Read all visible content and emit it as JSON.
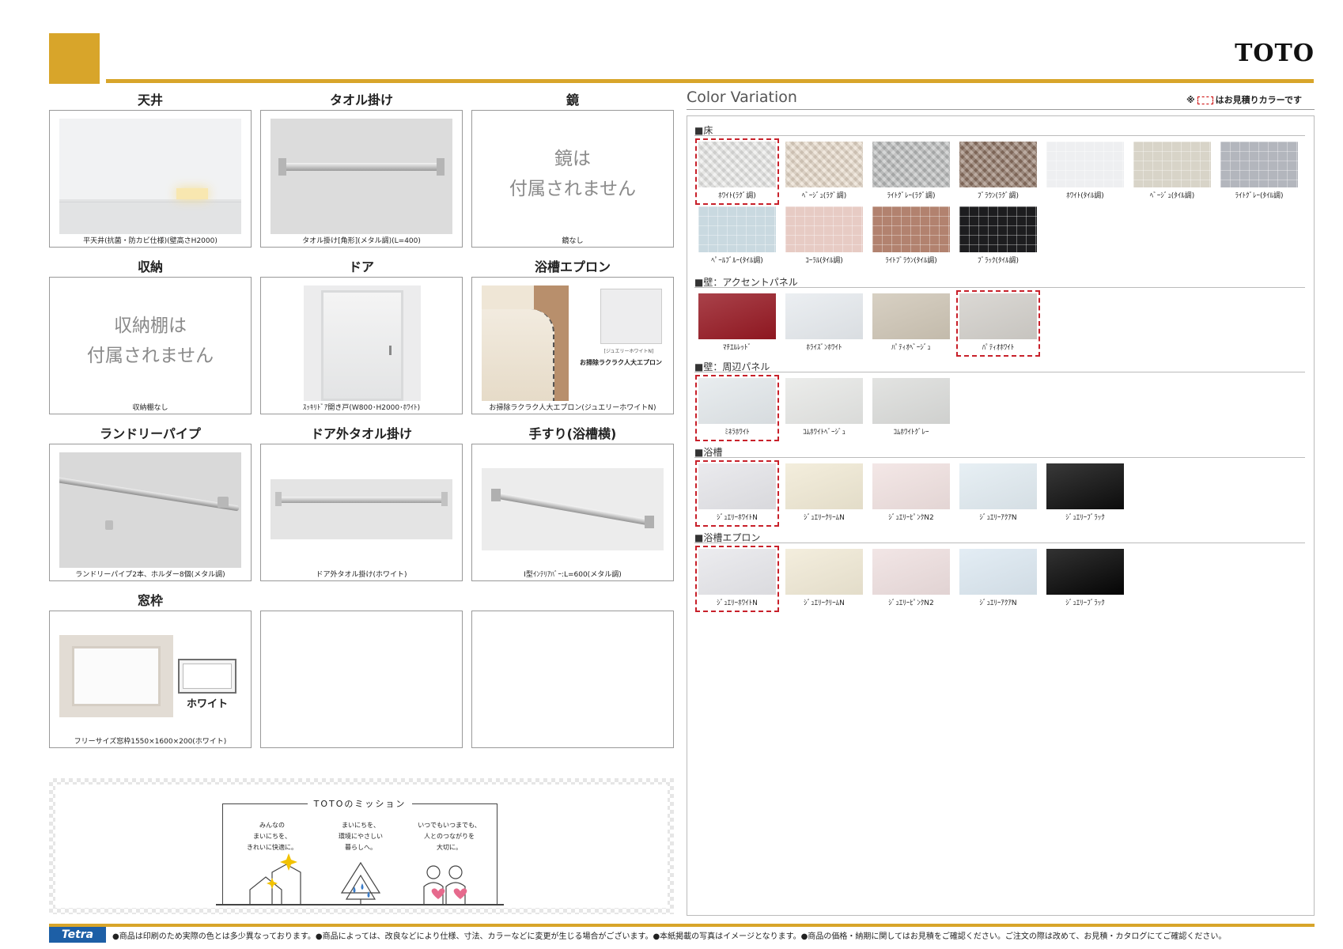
{
  "header": {
    "brand": "TOTO"
  },
  "options": [
    {
      "title": "天井",
      "caption": "平天井(抗菌・防カビ仕様)(壁高さH2000)"
    },
    {
      "title": "タオル掛け",
      "caption": "タオル掛け[角形](メタル調)(L=400)"
    },
    {
      "title": "鏡",
      "caption": "鏡なし",
      "notice": [
        "鏡は",
        "付属されません"
      ]
    },
    {
      "title": "収納",
      "caption": "収納棚なし",
      "notice": [
        "収納棚は",
        "付属されません"
      ]
    },
    {
      "title": "ドア",
      "caption": "ｽｯｷﾘﾄﾞｱ開き戸(W800･H2000･ﾎﾜｲﾄ)"
    },
    {
      "title": "浴槽エプロン",
      "caption": "お掃除ラクラク人大エプロン(ジュエリーホワイトN)",
      "inset_label": "[ジュエリーホワイトN]",
      "inset_note": "お掃除ラクラク人大エプロン"
    },
    {
      "title": "ランドリーパイプ",
      "caption": "ランドリーパイプ2本、ホルダー8個(メタル調)"
    },
    {
      "title": "ドア外タオル掛け",
      "caption": "ドア外タオル掛け(ホワイト)"
    },
    {
      "title": "手すり(浴槽横)",
      "caption": "I型ｲﾝﾃﾘｱﾊﾞｰ:L=600(メタル調)"
    },
    {
      "title": "窓枠",
      "caption": "フリーサイズ窓枠1550×1600×200(ホワイト)",
      "inset_label": "ホワイト"
    }
  ],
  "mission": {
    "title": "TOTOのミッション",
    "columns": [
      [
        "みんなの",
        "まいにちを、",
        "きれいに快適に。"
      ],
      [
        "まいにちを、",
        "環境にやさしい",
        "暮らしへ。"
      ],
      [
        "いつでもいつまでも、",
        "人とのつながりを",
        "大切に。"
      ]
    ]
  },
  "color_variation": {
    "title": "Color Variation",
    "note_prefix": "※",
    "note_suffix": "はお見積りカラーです",
    "selected_color": "#c8202a",
    "sections": [
      {
        "label": "■床",
        "swatches": [
          {
            "name": "ﾎﾜｲﾄ(ﾗｸﾞ調)",
            "color": "#e9e9e7",
            "pattern": "rag",
            "selected": true
          },
          {
            "name": "ﾍﾞｰｼﾞｭ(ﾗｸﾞ調)",
            "color": "#e6d8c8",
            "pattern": "rag"
          },
          {
            "name": "ﾗｲﾄｸﾞﾚｰ(ﾗｸﾞ調)",
            "color": "#b9bbbb",
            "pattern": "rag"
          },
          {
            "name": "ﾌﾞﾗｳﾝ(ﾗｸﾞ調)",
            "color": "#8d7363",
            "pattern": "rag"
          },
          {
            "name": "ﾎﾜｲﾄ(ﾀｲﾙ調)",
            "color": "#eeeff1",
            "pattern": "tile"
          },
          {
            "name": "ﾍﾞｰｼﾞｭ(ﾀｲﾙ調)",
            "color": "#d8d4c8",
            "pattern": "tile"
          },
          {
            "name": "ﾗｲﾄｸﾞﾚｰ(ﾀｲﾙ調)",
            "color": "#b3b6bd",
            "pattern": "tile"
          },
          {
            "name": "ﾍﾟｰﾙﾌﾞﾙｰ(ﾀｲﾙ調)",
            "color": "#c9d9e0",
            "pattern": "tile"
          },
          {
            "name": "ｺｰﾗﾙ(ﾀｲﾙ調)",
            "color": "#e7cbc4",
            "pattern": "tile"
          },
          {
            "name": "ﾗｲﾄﾌﾞﾗｳﾝ(ﾀｲﾙ調)",
            "color": "#b2826f",
            "pattern": "tile"
          },
          {
            "name": "ﾌﾞﾗｯｸ(ﾀｲﾙ調)",
            "color": "#1d1d1f",
            "pattern": "tile"
          }
        ]
      },
      {
        "label": "■壁：アクセントパネル",
        "swatches": [
          {
            "name": "ﾏﾁｴﾙﾚｯﾄﾞ",
            "color": "#961822",
            "pattern": "flat"
          },
          {
            "name": "ﾎﾗｲｽﾞﾝﾎﾜｲﾄ",
            "color": "#e7ebef",
            "pattern": "flat"
          },
          {
            "name": "ﾊﾟﾃｨｵﾍﾞｰｼﾞｭ",
            "color": "#cfc6b6",
            "pattern": "flat"
          },
          {
            "name": "ﾊﾟﾃｨｵﾎﾜｲﾄ",
            "color": "#d3d0cb",
            "pattern": "flat",
            "selected": true
          }
        ]
      },
      {
        "label": "■壁：周辺パネル",
        "swatches": [
          {
            "name": "ﾐﾈﾗﾎﾜｲﾄ",
            "color": "#e4e9ec",
            "pattern": "flat",
            "selected": true
          },
          {
            "name": "ｺﾑﾎﾜｲﾄﾍﾞｰｼﾞｭ",
            "color": "#e7e8e6",
            "pattern": "flat"
          },
          {
            "name": "ｺﾑﾎﾜｲﾄｸﾞﾚｰ",
            "color": "#dcdddb",
            "pattern": "flat"
          }
        ]
      },
      {
        "label": "■浴槽",
        "swatches": [
          {
            "name": "ｼﾞｭｴﾘｰﾎﾜｲﾄN",
            "color": "#e6e6ea",
            "pattern": "flat",
            "selected": true
          },
          {
            "name": "ｼﾞｭｴﾘｰｸﾘｰﾑN",
            "color": "#f1ead5",
            "pattern": "flat"
          },
          {
            "name": "ｼﾞｭｴﾘｰﾋﾟﾝｸN2",
            "color": "#f1e2e1",
            "pattern": "flat"
          },
          {
            "name": "ｼﾞｭｴﾘｰｱｸｱN",
            "color": "#e2ecf2",
            "pattern": "flat"
          },
          {
            "name": "ｼﾞｭｴﾘｰﾌﾞﾗｯｸ",
            "color": "#0d0d0d",
            "pattern": "flat"
          }
        ]
      },
      {
        "label": "■浴槽エプロン",
        "swatches": [
          {
            "name": "ｼﾞｭｴﾘｰﾎﾜｲﾄN",
            "color": "#e8e8ec",
            "pattern": "flat",
            "selected": true
          },
          {
            "name": "ｼﾞｭｴﾘｰｸﾘｰﾑN",
            "color": "#f1ead6",
            "pattern": "flat"
          },
          {
            "name": "ｼﾞｭｴﾘｰﾋﾟﾝｸN2",
            "color": "#efe0e0",
            "pattern": "flat"
          },
          {
            "name": "ｼﾞｭｴﾘｰｱｸｱN",
            "color": "#dde9f2",
            "pattern": "flat"
          },
          {
            "name": "ｼﾞｭｴﾘｰﾌﾞﾗｯｸ",
            "color": "#050505",
            "pattern": "flat"
          }
        ]
      }
    ]
  },
  "footer": {
    "badge": "Tetra",
    "disclaimer": "●商品は印刷のため実際の色とは多少異なっております。●商品によっては、改良などにより仕様、寸法、カラーなどに変更が生じる場合がございます。●本紙掲載の写真はイメージとなります。●商品の価格・納期に関してはお見積をご確認ください。ご注文の際は改めて、お見積・カタログにてご確認ください。"
  },
  "colors": {
    "accent": "#d8a52a",
    "badge": "#1d5fa6"
  }
}
